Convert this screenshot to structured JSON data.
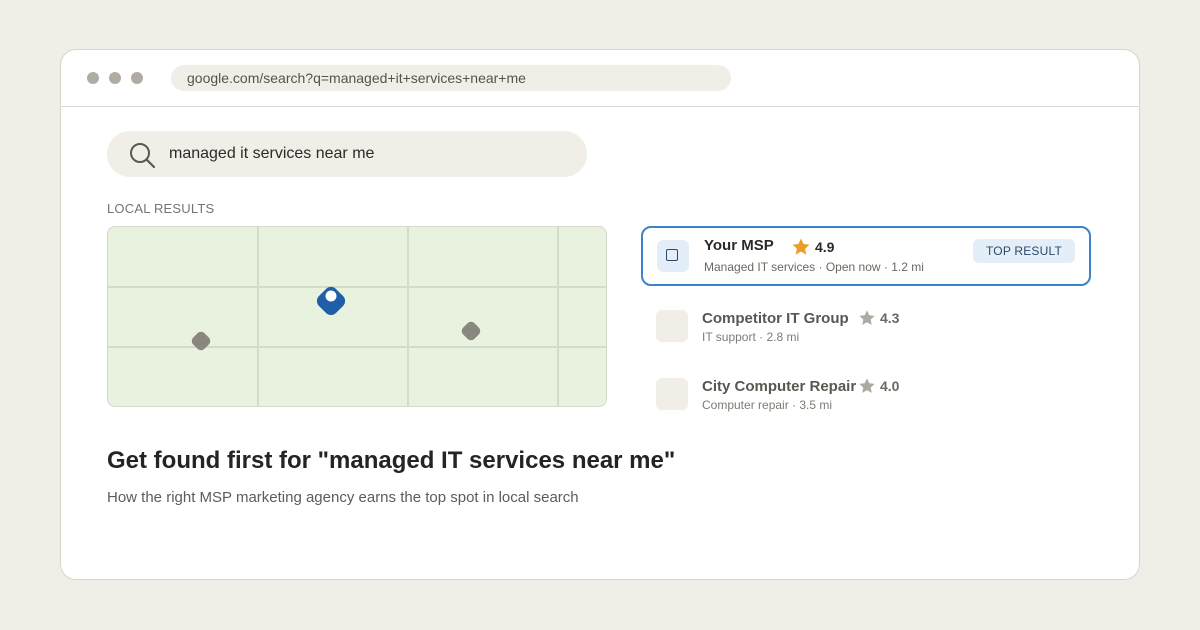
{
  "browser": {
    "url": "google.com/search?q=managed+it+services+near+me"
  },
  "search": {
    "query": "managed it services near me"
  },
  "section_label": "LOCAL RESULTS",
  "map": {
    "pins": [
      {
        "name": "primary-pin",
        "color": "#1f5fa8"
      },
      {
        "name": "secondary-pin",
        "color": "#8a877f"
      }
    ]
  },
  "results": [
    {
      "name": "Your MSP",
      "rating": "4.9",
      "meta": "Managed IT services · Open now · 1.2 mi",
      "badge": "TOP RESULT",
      "star_color": "#e8a02a"
    },
    {
      "name": "Competitor IT Group",
      "rating": "4.3",
      "meta": "IT support · 2.8 mi",
      "star_color": "#aeaaa3"
    },
    {
      "name": "City Computer Repair",
      "rating": "4.0",
      "meta": "Computer repair · 3.5 mi",
      "star_color": "#aeaaa3"
    }
  ],
  "headline": "Get found first for \"managed IT services near me\"",
  "subline": "How the right MSP marketing agency earns the top spot in local search",
  "colors": {
    "accent": "#3c82c8",
    "page_bg": "#f1eee8"
  }
}
